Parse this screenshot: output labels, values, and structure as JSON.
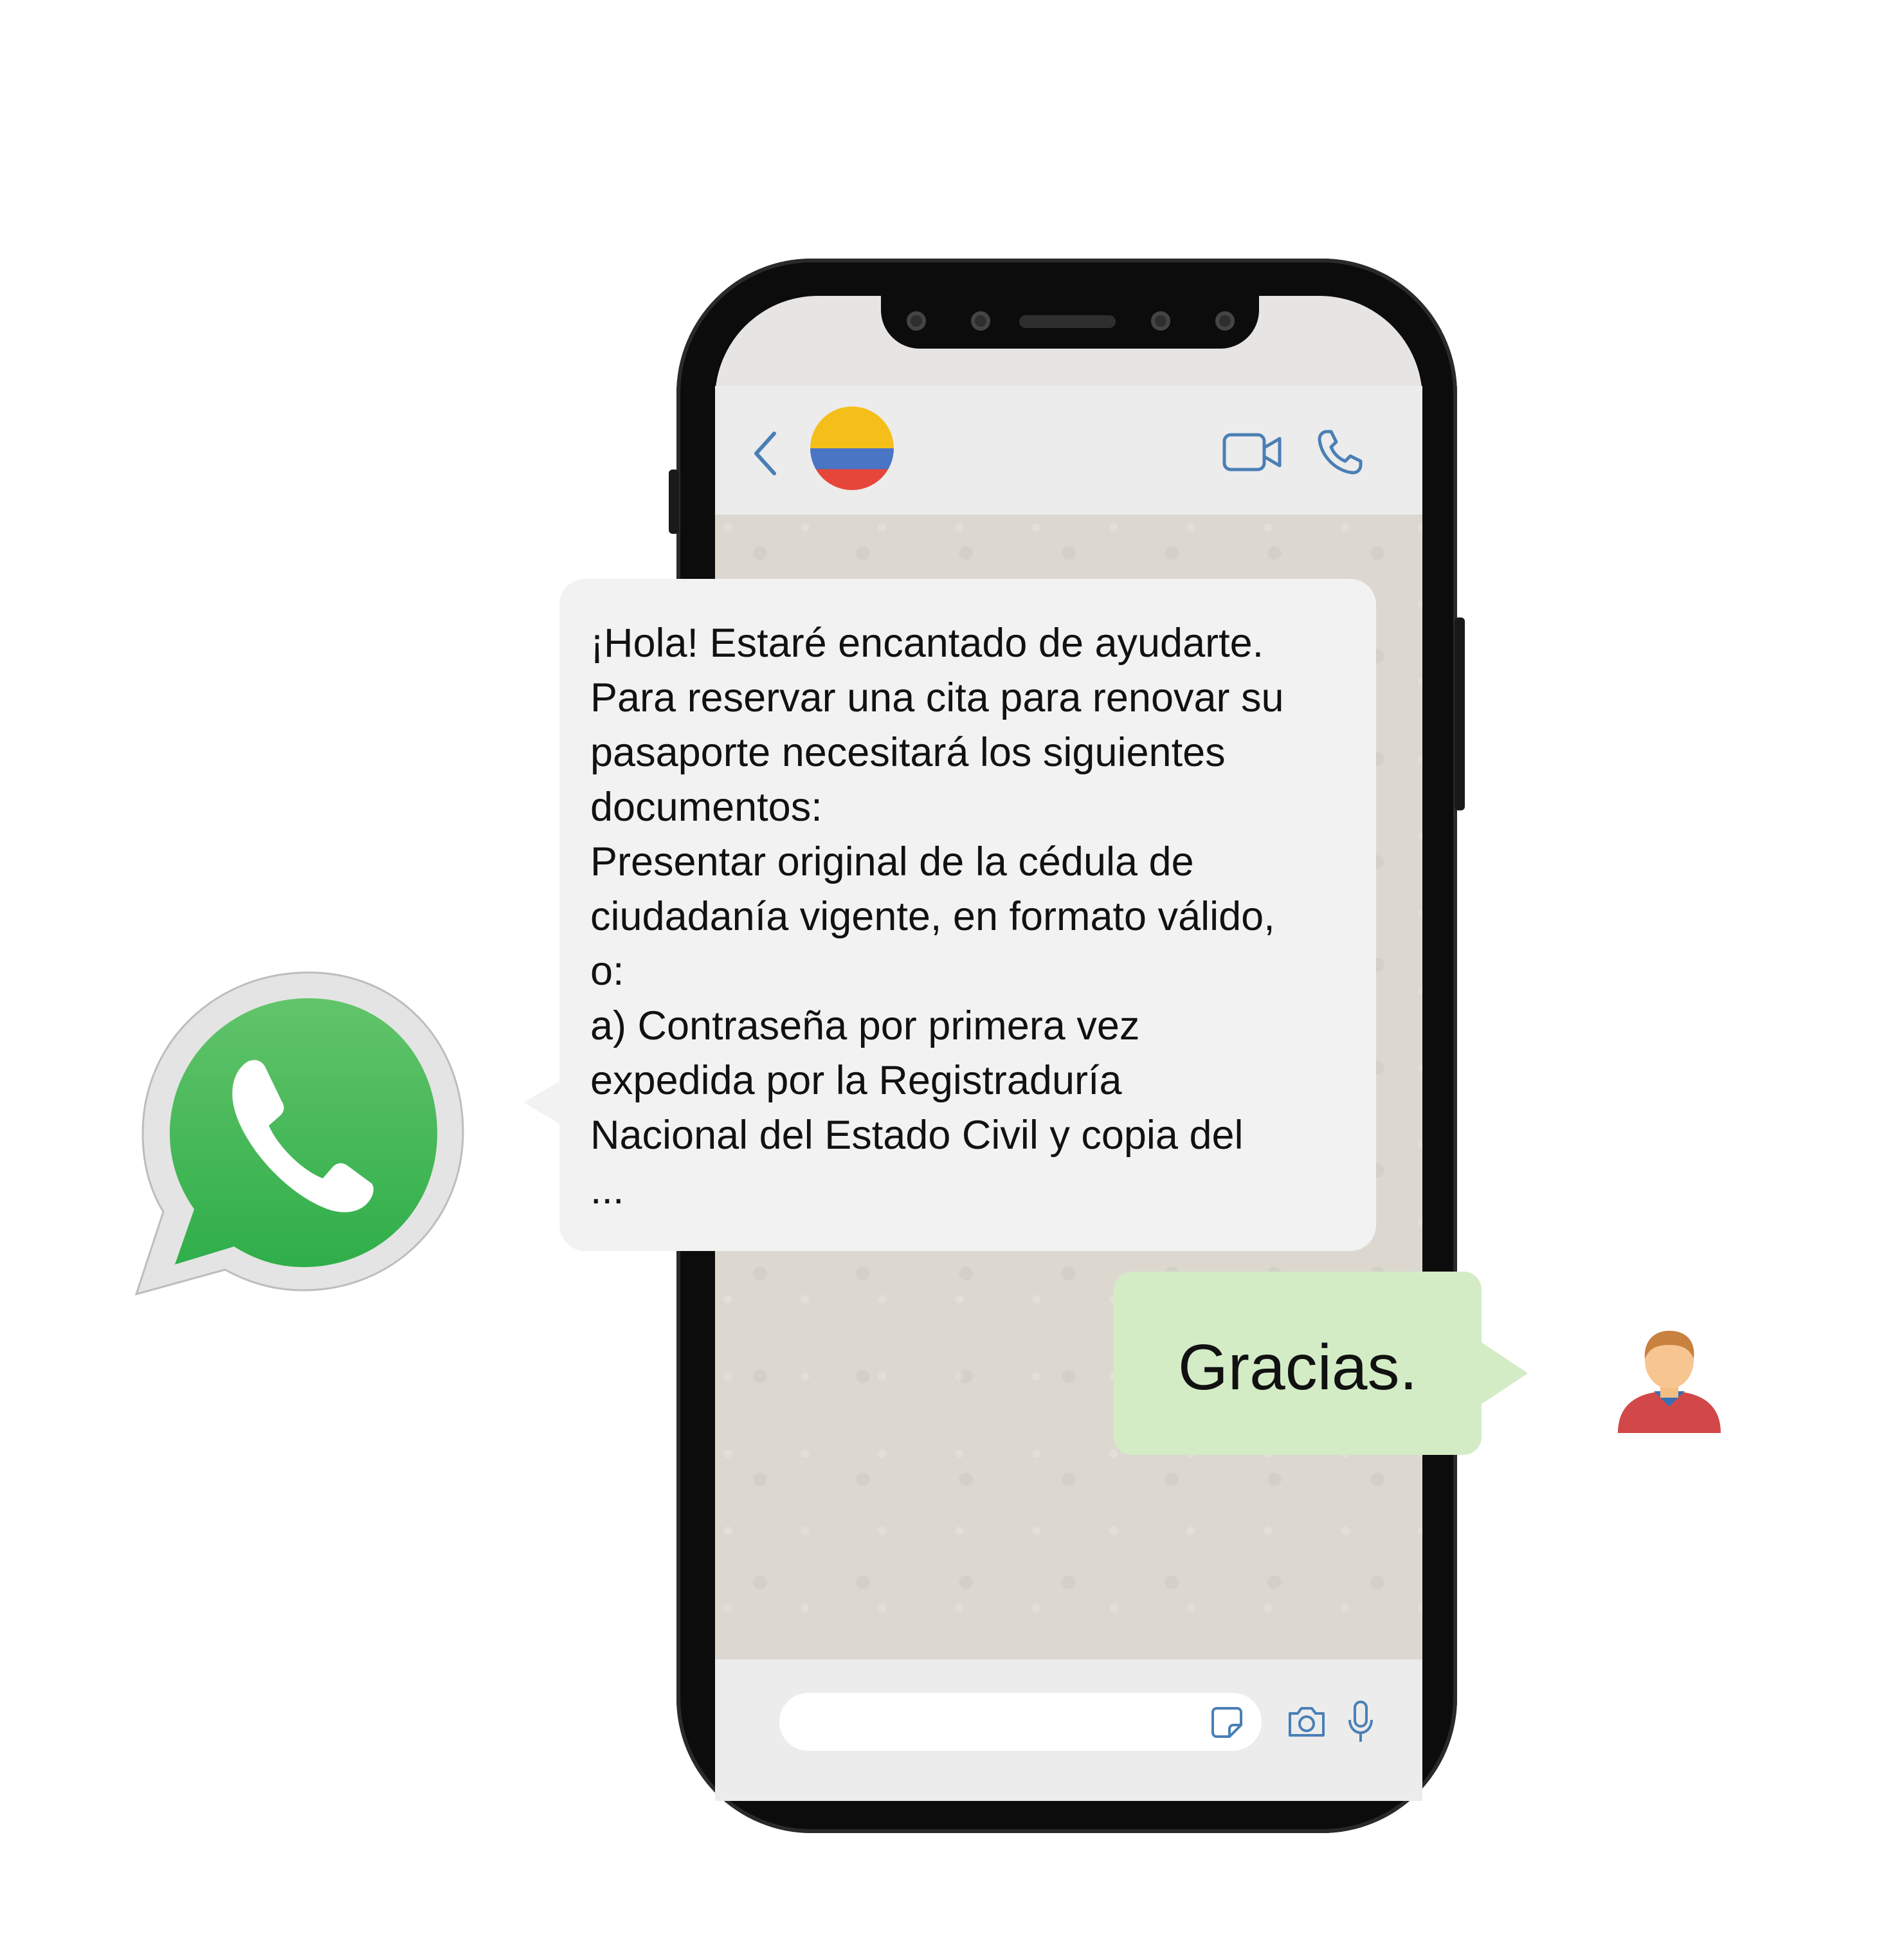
{
  "header": {
    "back_icon": "chevron-left-icon",
    "contact_avatar": "colombia-flag",
    "video_icon": "video-camera-icon",
    "call_icon": "phone-icon"
  },
  "colors": {
    "accent": "#4a7fb5",
    "incoming_bubble": "#f2f2f2",
    "outgoing_bubble": "#d3ecc6",
    "whatsapp_green": "#4cbf5a",
    "flag_yellow": "#f5bf1a",
    "flag_blue": "#4a74c4",
    "flag_red": "#e6463a"
  },
  "messages": {
    "incoming": {
      "lines": [
        "¡Hola! Estaré encantado de ayudarte.",
        "Para reservar una cita para renovar su",
        "pasaporte necesitará los siguientes",
        "documentos:",
        "Presentar original de la cédula de",
        "ciudadanía vigente, en formato válido,",
        "o:",
        "a) Contraseña por primera vez",
        "expedida por la Registraduría",
        "Nacional del Estado Civil y copia del",
        "..."
      ]
    },
    "outgoing": {
      "text": "Gracias."
    }
  },
  "footer": {
    "sticker_icon": "sticker-icon",
    "camera_icon": "camera-icon",
    "mic_icon": "microphone-icon"
  },
  "decorations": {
    "logo": "whatsapp-logo-icon",
    "user": "user-avatar-icon"
  }
}
